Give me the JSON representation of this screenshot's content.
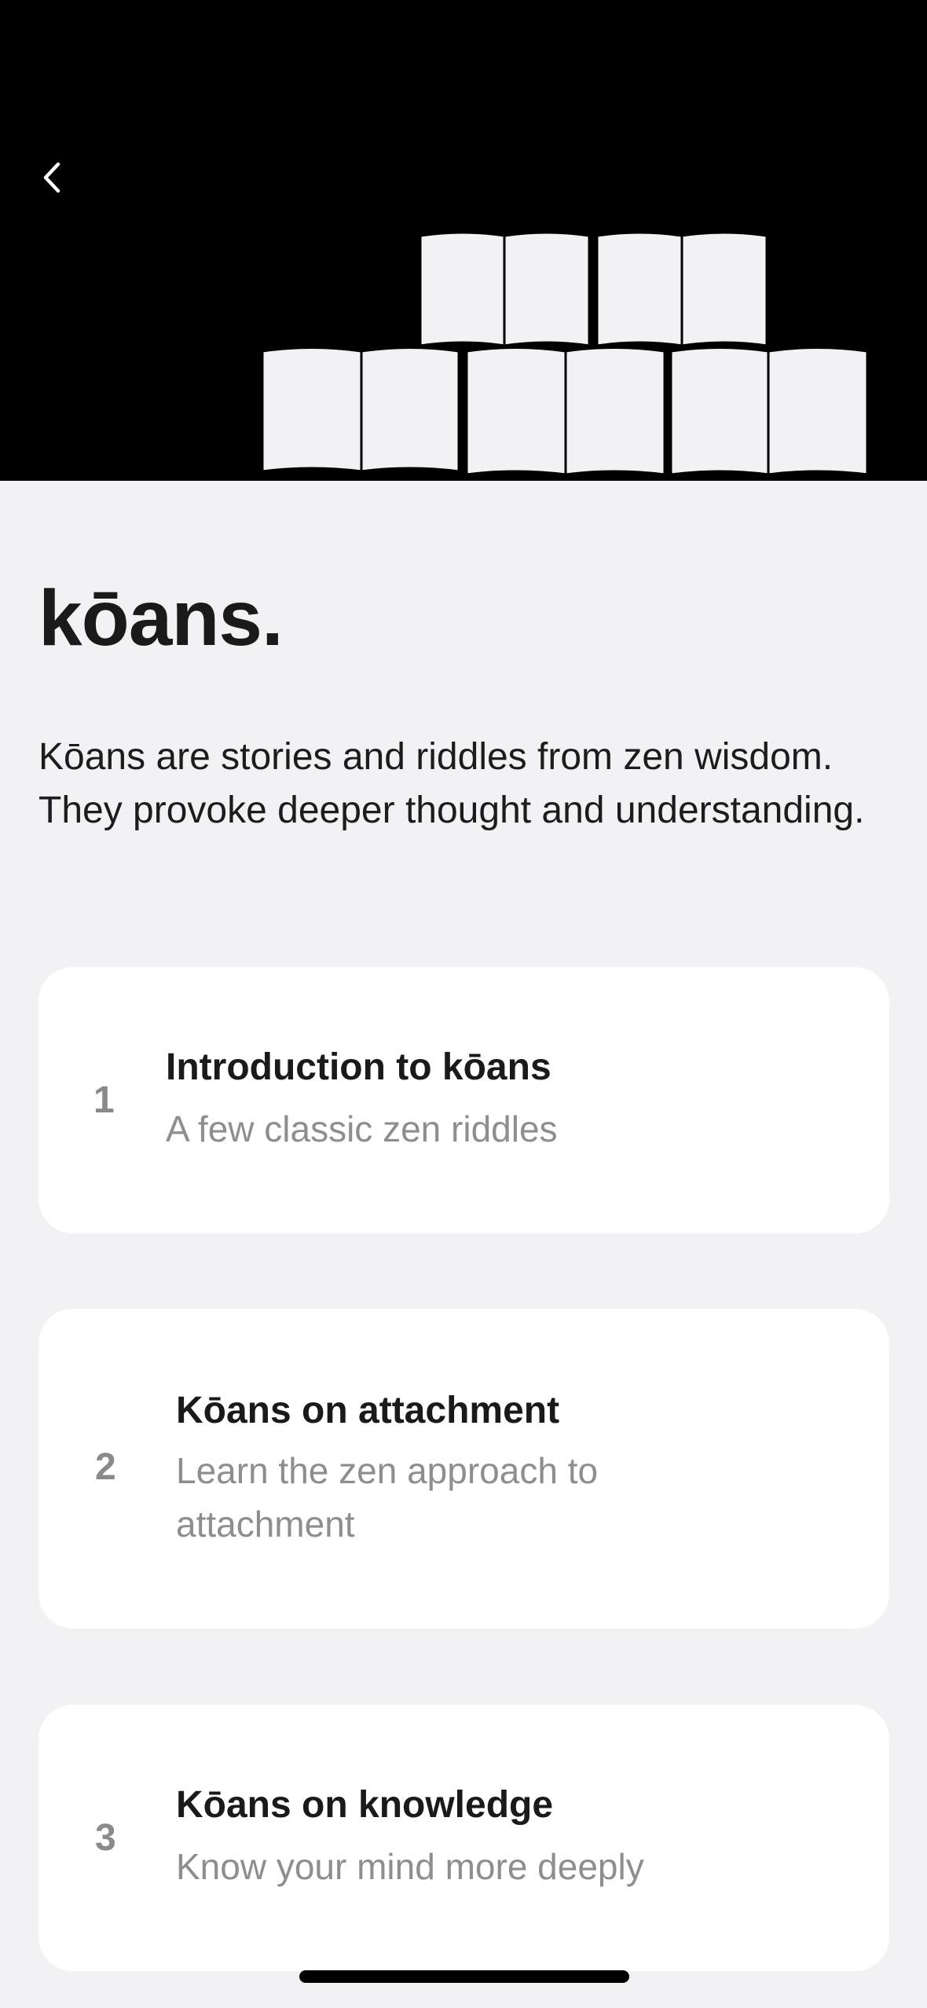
{
  "header": {
    "back_icon": "chevron-left-icon",
    "illustration_icon": "open-books-icon",
    "background_color": "#000000",
    "book_color": "#f2f2f4"
  },
  "page": {
    "title": "kōans.",
    "description": "Kōans are stories and riddles from zen wisdom. They provoke deeper thought and understanding."
  },
  "lessons": [
    {
      "number": "1",
      "title": "Introduction to kōans",
      "subtitle": "A few classic zen riddles"
    },
    {
      "number": "2",
      "title": "Kōans on attachment",
      "subtitle": "Learn the zen approach to attachment"
    },
    {
      "number": "3",
      "title": "Kōans on knowledge",
      "subtitle": "Know your mind more deeply"
    }
  ],
  "colors": {
    "background": "#f2f2f4",
    "card": "#ffffff",
    "text_primary": "#1a1a1a",
    "text_secondary": "#8e8e8e"
  }
}
